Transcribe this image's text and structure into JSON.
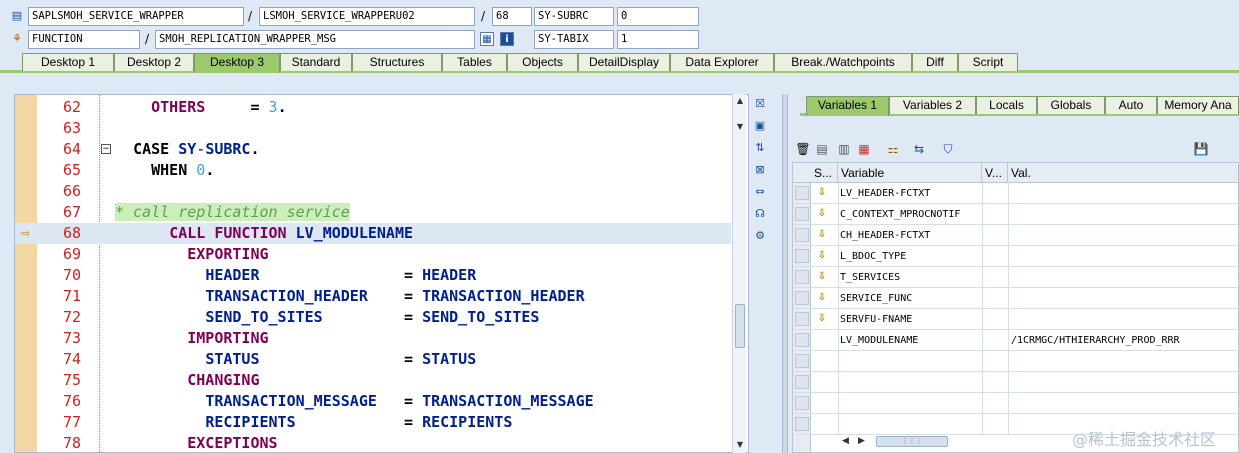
{
  "info": {
    "row1": {
      "program": "SAPLSMOH_SERVICE_WRAPPER",
      "include": "LSMOH_SERVICE_WRAPPERU02",
      "line": "68",
      "sysvar": "SY-SUBRC",
      "sysval": "0"
    },
    "row2": {
      "type": "FUNCTION",
      "name": "SMOH_REPLICATION_WRAPPER_MSG",
      "sysvar": "SY-TABIX",
      "sysval": "1"
    },
    "separator": "/"
  },
  "main_tabs": [
    "Desktop 1",
    "Desktop 2",
    "Desktop 3",
    "Standard",
    "Structures",
    "Tables",
    "Objects",
    "DetailDisplay",
    "Data Explorer",
    "Break./Watchpoints",
    "Diff",
    "Script"
  ],
  "active_main_tab": "Desktop 3",
  "code": {
    "line_numbers": [
      "62",
      "63",
      "64",
      "65",
      "66",
      "67",
      "68",
      "69",
      "70",
      "71",
      "72",
      "73",
      "74",
      "75",
      "76",
      "77",
      "78"
    ],
    "current_line": "68",
    "l62a": "OTHERS",
    "l62b": "=",
    "l62c": "3",
    "l62d": ".",
    "l64a": "CASE",
    "l64b": "SY",
    "l64c": "-",
    "l64d": "SUBRC",
    "l64e": ".",
    "l65a": "WHEN",
    "l65b": "0",
    "l65c": ".",
    "l67": "* call replication service",
    "l68a": "CALL FUNCTION",
    "l68b": "LV_MODULENAME",
    "l69": "EXPORTING",
    "l70a": "HEADER",
    "l70b": "=",
    "l70c": "HEADER",
    "l71a": "TRANSACTION_HEADER",
    "l71b": "=",
    "l71c": "TRANSACTION_HEADER",
    "l72a": "SEND_TO_SITES",
    "l72b": "=",
    "l72c": "SEND_TO_SITES",
    "l73": "IMPORTING",
    "l74a": "STATUS",
    "l74b": "=",
    "l74c": "STATUS",
    "l75": "CHANGING",
    "l76a": "TRANSACTION_MESSAGE",
    "l76b": "=",
    "l76c": "TRANSACTION_MESSAGE",
    "l77a": "RECIPIENTS",
    "l77b": "=",
    "l77c": "RECIPIENTS",
    "l78": "EXCEPTIONS"
  },
  "right_tabs": [
    "Variables 1",
    "Variables 2",
    "Locals",
    "Globals",
    "Auto",
    "Memory Ana"
  ],
  "active_right_tab": "Variables 1",
  "grid": {
    "headers": {
      "s": "S...",
      "variable": "Variable",
      "v": "V...",
      "val": "Val."
    },
    "rows": [
      {
        "variable": "LV_HEADER-FCTXT",
        "value": ""
      },
      {
        "variable": "C_CONTEXT_MPROCNOTIF",
        "value": ""
      },
      {
        "variable": "CH_HEADER-FCTXT",
        "value": ""
      },
      {
        "variable": "L_BDOC_TYPE",
        "value": ""
      },
      {
        "variable": "T_SERVICES",
        "value": ""
      },
      {
        "variable": "SERVICE_FUNC",
        "value": ""
      },
      {
        "variable": "SERVFU-FNAME",
        "value": ""
      },
      {
        "variable": "LV_MODULENAME",
        "value": "/1CRMGC/HTHIERARCHY_PROD_RRR"
      }
    ]
  },
  "watermark": "@稀土掘金技术社区",
  "colors": {
    "accent_tab": "#9cc96b",
    "line_number": "#d12020",
    "keyword": "#7f0055",
    "identifier": "#00208e"
  }
}
